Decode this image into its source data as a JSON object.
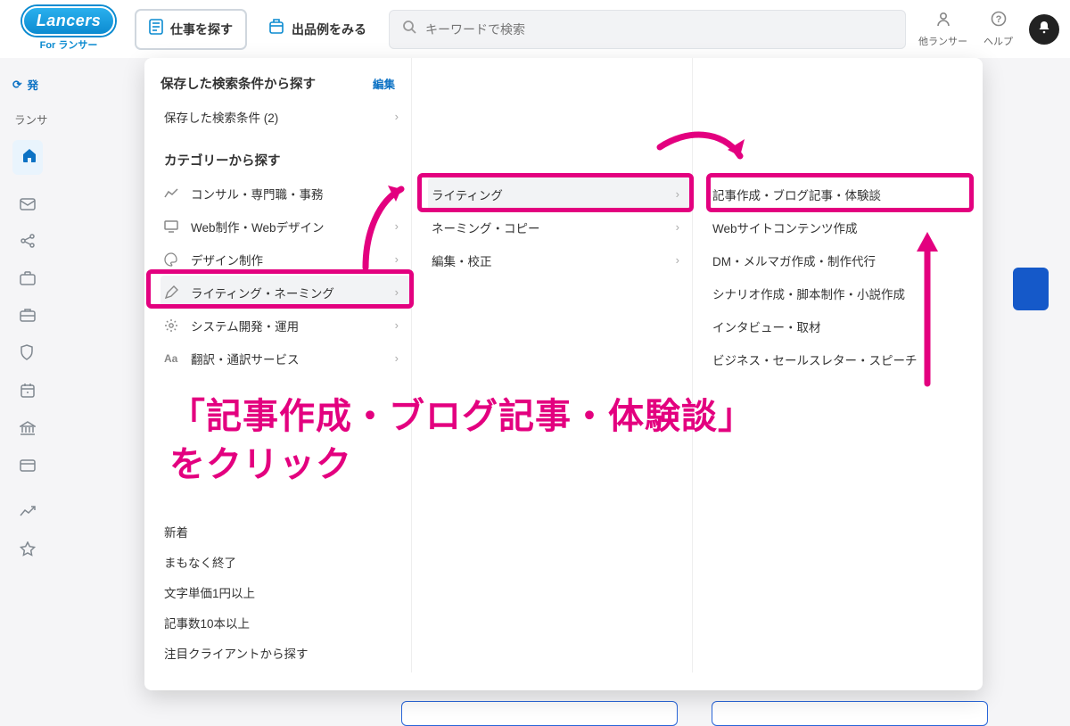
{
  "header": {
    "logo_text": "Lancers",
    "logo_subtitle": "For ランサー",
    "nav_find_work": "仕事を探す",
    "nav_examples": "出品例をみる",
    "search_placeholder": "キーワードで検索",
    "other_lancers": "他ランサー",
    "help": "ヘルプ"
  },
  "rail": {
    "refresh_label": "発",
    "sub": "ランサ"
  },
  "mega": {
    "saved_header": "保存した検索条件から探す",
    "edit": "編集",
    "saved_item": "保存した検索条件 (2)",
    "cat_header": "カテゴリーから探す",
    "cats": [
      "コンサル・専門職・事務",
      "Web制作・Webデザイン",
      "デザイン制作",
      "ライティング・ネーミング",
      "システム開発・運用",
      "翻訳・通訳サービス"
    ],
    "col2": [
      "ライティング",
      "ネーミング・コピー",
      "編集・校正"
    ],
    "col3": [
      "記事作成・ブログ記事・体験談",
      "Webサイトコンテンツ作成",
      "DM・メルマガ作成・制作代行",
      "シナリオ作成・脚本制作・小説作成",
      "インタビュー・取材",
      "ビジネス・セールスレター・スピーチ"
    ],
    "filters": [
      "新着",
      "まもなく終了",
      "文字単価1円以上",
      "記事数10本以上",
      "注目クライアントから探す"
    ]
  },
  "annotation": {
    "line1": "「記事作成・ブログ記事・体験談」",
    "line2": "をクリック"
  }
}
